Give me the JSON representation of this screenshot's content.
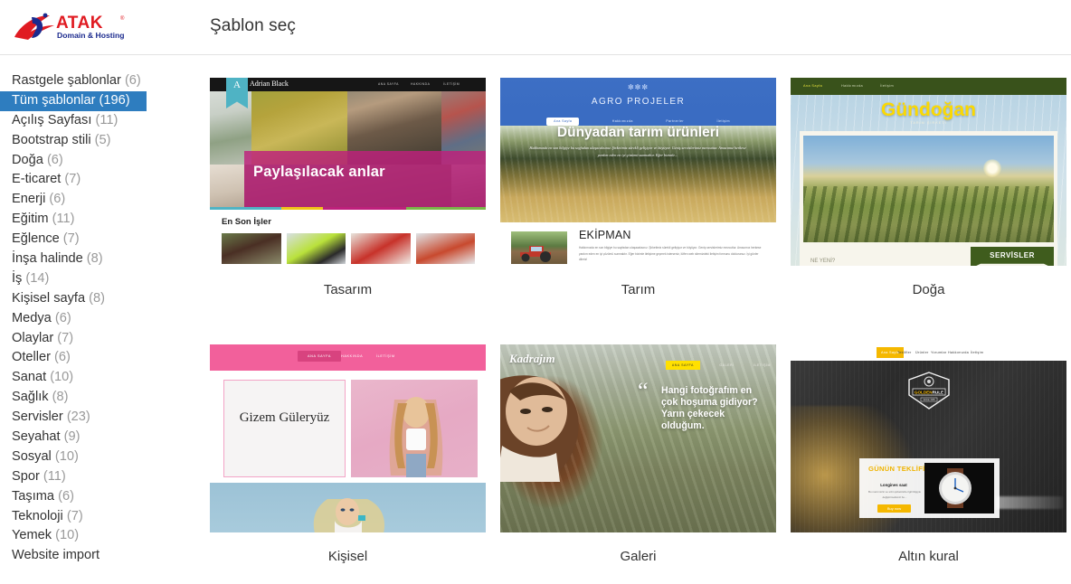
{
  "header": {
    "logo": {
      "name": "ATAK",
      "tagline": "Domain & Hosting",
      "icon": "atak-logo-icon"
    },
    "title": "Şablon seç"
  },
  "sidebar": {
    "items": [
      {
        "label": "Rastgele şablonlar",
        "count": "(6)",
        "selected": false
      },
      {
        "label": "Tüm şablonlar (196)",
        "count": "",
        "selected": true
      },
      {
        "label": "Açılış Sayfası",
        "count": "(11)",
        "selected": false
      },
      {
        "label": "Bootstrap stili",
        "count": "(5)",
        "selected": false
      },
      {
        "label": "Doğa",
        "count": "(6)",
        "selected": false
      },
      {
        "label": "E-ticaret",
        "count": "(7)",
        "selected": false
      },
      {
        "label": "Enerji",
        "count": "(6)",
        "selected": false
      },
      {
        "label": "Eğitim",
        "count": "(11)",
        "selected": false
      },
      {
        "label": "Eğlence",
        "count": "(7)",
        "selected": false
      },
      {
        "label": "İnşa halinde",
        "count": "(8)",
        "selected": false
      },
      {
        "label": "İş",
        "count": "(14)",
        "selected": false
      },
      {
        "label": "Kişisel sayfa",
        "count": "(8)",
        "selected": false
      },
      {
        "label": "Medya",
        "count": "(6)",
        "selected": false
      },
      {
        "label": "Olaylar",
        "count": "(7)",
        "selected": false
      },
      {
        "label": "Oteller",
        "count": "(6)",
        "selected": false
      },
      {
        "label": "Sanat",
        "count": "(10)",
        "selected": false
      },
      {
        "label": "Sağlık",
        "count": "(8)",
        "selected": false
      },
      {
        "label": "Servisler",
        "count": "(23)",
        "selected": false
      },
      {
        "label": "Seyahat",
        "count": "(9)",
        "selected": false
      },
      {
        "label": "Sosyal",
        "count": "(10)",
        "selected": false
      },
      {
        "label": "Spor",
        "count": "(11)",
        "selected": false
      },
      {
        "label": "Taşıma",
        "count": "(6)",
        "selected": false
      },
      {
        "label": "Teknoloji",
        "count": "(7)",
        "selected": false
      },
      {
        "label": "Yemek",
        "count": "(10)",
        "selected": false
      },
      {
        "label": "Website import",
        "count": "",
        "selected": false
      }
    ]
  },
  "templates": [
    {
      "caption": "Tasarım",
      "brand": "Adrian Black",
      "banner": "Paylaşılacak anlar",
      "section": "En Son İşler",
      "nav": [
        "ANA SAYFA",
        "HAKKINDA",
        "İLETİŞİM"
      ],
      "ribbon_letter": "A"
    },
    {
      "caption": "Tarım",
      "brand": "AGRO PROJELER",
      "hero_title": "Dünyadan tarım ürünleri",
      "hero_text": "Hakkımızda en son bilgiye bu sayfadan ulaşacaksınız. Şirketimiz sürekli gelişiyor ve büyüyor. Geniş servislerimiz mevcuttur. Amacımız herkese yardım eden en iyi çözümü sunmaktır. Eğer bizimle...",
      "section": "EKİPMAN",
      "section_text": "Hakkımızda en son bilgiye bu sayfadan ulaşacaksınız. Şirketimiz sürekli gelişiyor ve büyüyor. Geniş servislerimiz mevcuttur. Amacımız herkese yardım eden en iyi çözümü sunmaktır. Eğer bizimle iletişime geçmek isterseniz, lütfen web sitemizdeki iletişim formunu doldurunuz. İyi günler dileriz!",
      "nav": [
        "Ana Sayfa",
        "Hakkımızda",
        "Partnerler",
        "İletişim"
      ]
    },
    {
      "caption": "Doğa",
      "brand": "Gündoğan",
      "sub": "TARIM ŞİRKETİ",
      "nav": [
        "Ana Sayfa",
        "Hakkımızda",
        "İletişim"
      ],
      "heading": "NE YENİ?",
      "ribbon": "SERVİSLER"
    },
    {
      "caption": "Kişisel",
      "brand": "Gizem Güleryüz",
      "nav": [
        "ANA SAYFA",
        "HAKKINDA",
        "İLETİŞİM"
      ]
    },
    {
      "caption": "Galeri",
      "brand": "Kadrajım",
      "quote": "Hangi fotoğrafım en çok hoşuma gidiyor? Yarın çekecek olduğum.",
      "nav": [
        "ANA SAYFA",
        "GALERİ",
        "İLETİŞİM"
      ]
    },
    {
      "caption": "Altın kural",
      "brand": "GOLDENRULE",
      "brand_since": "SINCE 1985",
      "offer_title": "GÜNÜN TEKLİFİ",
      "offer_name": "Longines saat",
      "offer_text": "Bu metni sizin ve sizin şirketinizle ilgili bilgiyle değiştirmelisiniz bu...",
      "offer_button": "Buy now",
      "nav": [
        "Ana Sayfa",
        "Teklifler",
        "Ürünler",
        "Yorumlar",
        "Hakkımızda",
        "İletişim"
      ]
    }
  ],
  "colors": {
    "accent": "#2e7dbf",
    "logo_red": "#e01b22",
    "logo_blue": "#1b2a8e",
    "muted": "#999999"
  }
}
